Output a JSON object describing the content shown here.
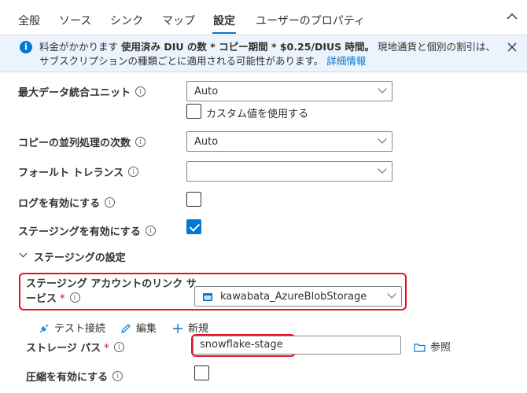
{
  "tabs": [
    {
      "label": "全般"
    },
    {
      "label": "ソース"
    },
    {
      "label": "シンク"
    },
    {
      "label": "マップ"
    },
    {
      "label": "設定",
      "active": true
    },
    {
      "label": "ユーザーのプロパティ"
    }
  ],
  "banner": {
    "text_1": "料金がかかります ",
    "text_bold": "使用済み DIU の数 * コピー期間 * $0.25/DIUS 時間。",
    "text_2": " 現地通貨と個別の割引は、サブスクリプションの種類ごとに適用される可能性があります。",
    "link": "詳細情報"
  },
  "form": {
    "diu": {
      "label": "最大データ統合ユニット",
      "value": "Auto"
    },
    "custom_value": {
      "label": "カスタム値を使用する",
      "checked": false
    },
    "parallel": {
      "label": "コピーの並列処理の次数",
      "value": "Auto"
    },
    "fault": {
      "label": "フォールト トレランス",
      "value": ""
    },
    "logging": {
      "label": "ログを有効にする",
      "checked": false
    },
    "staging": {
      "label": "ステージングを有効にする",
      "checked": true
    },
    "staging_section": {
      "label": "ステージングの設定"
    },
    "linked_service": {
      "label_line1": "ステージング アカウントのリンク サ",
      "label_line2": "ービス",
      "required": "*",
      "value": "kawabata_AzureBlobStorage"
    },
    "actions": {
      "test": "テスト接続",
      "edit": "編集",
      "new": "新規"
    },
    "storage_path": {
      "label": "ストレージ パス",
      "required": "*",
      "value": "snowflake-stage",
      "browse": "参照"
    },
    "compression": {
      "label": "圧縮を有効にする",
      "checked": false
    }
  },
  "colors": {
    "accent": "#0078d4",
    "highlight": "#e81123",
    "banner_bg": "#ebf3fc"
  }
}
